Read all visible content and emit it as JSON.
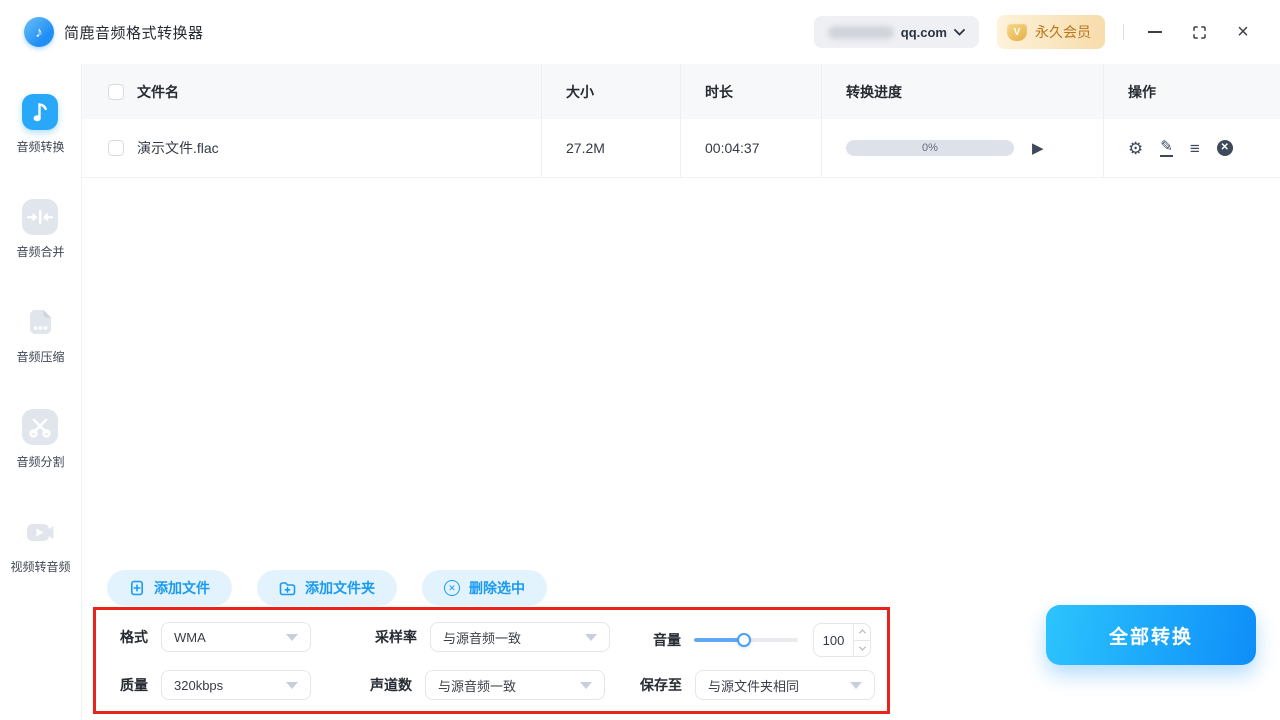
{
  "app": {
    "title": "简鹿音频格式转换器"
  },
  "topbar": {
    "account": {
      "email_visible": "qq.com"
    },
    "membership": {
      "label": "永久会员",
      "icon_letter": "V"
    },
    "window_icons": [
      "minimize-icon",
      "maximize-icon",
      "close-icon"
    ]
  },
  "sidebar": {
    "items": [
      {
        "label": "音频转换",
        "icon": "music-note-icon",
        "active": true
      },
      {
        "label": "音频合并",
        "icon": "merge-arrows-icon",
        "active": false
      },
      {
        "label": "音频压缩",
        "icon": "compress-file-icon",
        "active": false
      },
      {
        "label": "音频分割",
        "icon": "scissors-icon",
        "active": false
      },
      {
        "label": "视频转音频",
        "icon": "video-camera-icon",
        "active": false
      }
    ]
  },
  "table": {
    "columns": [
      "文件名",
      "大小",
      "时长",
      "转换进度",
      "操作"
    ],
    "rows": [
      {
        "filename": "演示文件.flac",
        "size": "27.2M",
        "duration": "00:04:37",
        "progress_text": "0%",
        "progress_percent": 0
      }
    ],
    "row_op_icons": [
      "settings-gear-icon",
      "edit-pencil-icon",
      "menu-list-icon",
      "remove-circle-icon"
    ]
  },
  "actions": {
    "add_file": "添加文件",
    "add_folder": "添加文件夹",
    "delete_selected": "删除选中"
  },
  "settings": {
    "format": {
      "label": "格式",
      "value": "WMA"
    },
    "sample_rate": {
      "label": "采样率",
      "value": "与源音频一致"
    },
    "volume": {
      "label": "音量",
      "value": "100",
      "slider_percent": 48
    },
    "quality": {
      "label": "质量",
      "value": "320kbps"
    },
    "channels": {
      "label": "声道数",
      "value": "与源音频一致"
    },
    "save_to": {
      "label": "保存至",
      "value": "与源文件夹相同"
    }
  },
  "convert_button": {
    "label": "全部转换"
  },
  "colors": {
    "accent_blue": "#1a9af2",
    "active_icon_blue": "#29a7f8",
    "convert_gradient_start": "#2cc4fd",
    "convert_gradient_end": "#0e8ef9",
    "annotation_red": "#e8231a",
    "member_text": "#b8751c",
    "member_bg": "#f8dcab",
    "progress_track": "#dde1e9",
    "icon_dark": "#3c4a5c"
  }
}
